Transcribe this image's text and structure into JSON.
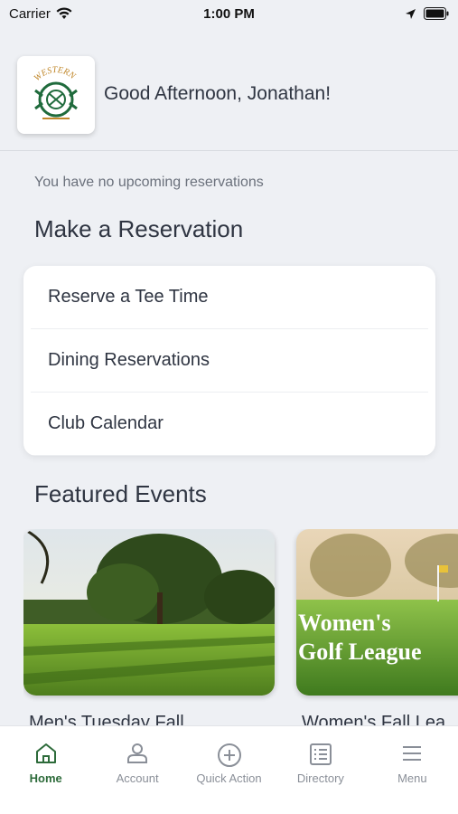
{
  "status_bar": {
    "carrier": "Carrier",
    "time": "1:00 PM"
  },
  "header": {
    "logo_text": "WESTERN",
    "greeting": "Good Afternoon, Jonathan!"
  },
  "reservations_notice": "You have no upcoming reservations",
  "make_reservation": {
    "title": "Make a Reservation",
    "items": [
      {
        "label": "Reserve a Tee Time"
      },
      {
        "label": "Dining Reservations"
      },
      {
        "label": "Club Calendar"
      }
    ]
  },
  "featured_events": {
    "title": "Featured Events",
    "events": [
      {
        "title": "Men's Tuesday Fall",
        "image_text": ""
      },
      {
        "title": "Women's Fall Lea",
        "image_text_line1": "Women's",
        "image_text_line2": "Golf League"
      }
    ]
  },
  "tab_bar": {
    "tabs": [
      {
        "label": "Home",
        "icon": "home-icon",
        "active": true
      },
      {
        "label": "Account",
        "icon": "person-icon",
        "active": false
      },
      {
        "label": "Quick Action",
        "icon": "plus-circle-icon",
        "active": false
      },
      {
        "label": "Directory",
        "icon": "list-icon",
        "active": false
      },
      {
        "label": "Menu",
        "icon": "hamburger-icon",
        "active": false
      }
    ]
  },
  "colors": {
    "accent": "#2d6b3a",
    "background": "#eef0f4"
  }
}
